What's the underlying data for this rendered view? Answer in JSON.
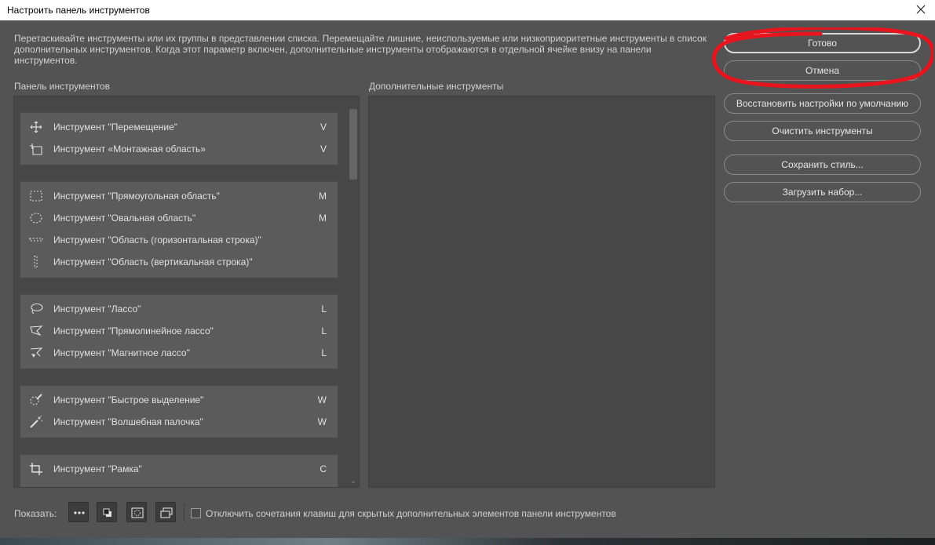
{
  "window": {
    "title": "Настроить панель инструментов"
  },
  "description": "Перетаскивайте инструменты или их группы в представлении списка. Перемещайте лишние, неиспользуемые или низкоприоритетные инструменты в список дополнительных инструментов. Когда этот параметр включен, дополнительные инструменты отображаются в отдельной ячейке внизу на панели инструментов.",
  "toolbar_panel": {
    "label": "Панель инструментов",
    "groups": [
      {
        "tools": [
          {
            "icon": "move-icon",
            "name": "Инструмент \"Перемещение\"",
            "key": "V"
          },
          {
            "icon": "artboard-icon",
            "name": "Инструмент «Монтажная область»",
            "key": "V"
          }
        ]
      },
      {
        "tools": [
          {
            "icon": "rectangular-marquee-icon",
            "name": "Инструмент \"Прямоугольная область\"",
            "key": "M"
          },
          {
            "icon": "elliptical-marquee-icon",
            "name": "Инструмент \"Овальная область\"",
            "key": "M"
          },
          {
            "icon": "single-row-marquee-icon",
            "name": "Инструмент \"Область (горизонтальная строка)\"",
            "key": ""
          },
          {
            "icon": "single-column-marquee-icon",
            "name": "Инструмент \"Область (вертикальная строка)\"",
            "key": ""
          }
        ]
      },
      {
        "tools": [
          {
            "icon": "lasso-icon",
            "name": "Инструмент \"Лассо\"",
            "key": "L"
          },
          {
            "icon": "polygonal-lasso-icon",
            "name": "Инструмент \"Прямолинейное лассо\"",
            "key": "L"
          },
          {
            "icon": "magnetic-lasso-icon",
            "name": "Инструмент \"Магнитное лассо\"",
            "key": "L"
          }
        ]
      },
      {
        "tools": [
          {
            "icon": "quick-selection-icon",
            "name": "Инструмент \"Быстрое выделение\"",
            "key": "W"
          },
          {
            "icon": "magic-wand-icon",
            "name": "Инструмент \"Волшебная палочка\"",
            "key": "W"
          }
        ]
      },
      {
        "tools": [
          {
            "icon": "crop-icon",
            "name": "Инструмент \"Рамка\"",
            "key": "C"
          }
        ]
      }
    ]
  },
  "extra_panel": {
    "label": "Дополнительные инструменты"
  },
  "buttons": {
    "done": "Готово",
    "cancel": "Отмена",
    "restore_defaults": "Восстановить настройки по умолчанию",
    "clear_tools": "Очистить инструменты",
    "save_preset": "Сохранить стиль...",
    "load_preset": "Загрузить набор..."
  },
  "bottom_bar": {
    "show_label": "Показать:",
    "show_buttons": [
      "more-tools-icon",
      "foreground-background-icon",
      "quick-mask-icon",
      "screen-mode-icon"
    ],
    "checkbox_label": "Отключить сочетания клавиш для скрытых дополнительных элементов панели инструментов",
    "checkbox_checked": false
  },
  "annotation": {
    "color": "#e8141e",
    "target": "done-button"
  }
}
